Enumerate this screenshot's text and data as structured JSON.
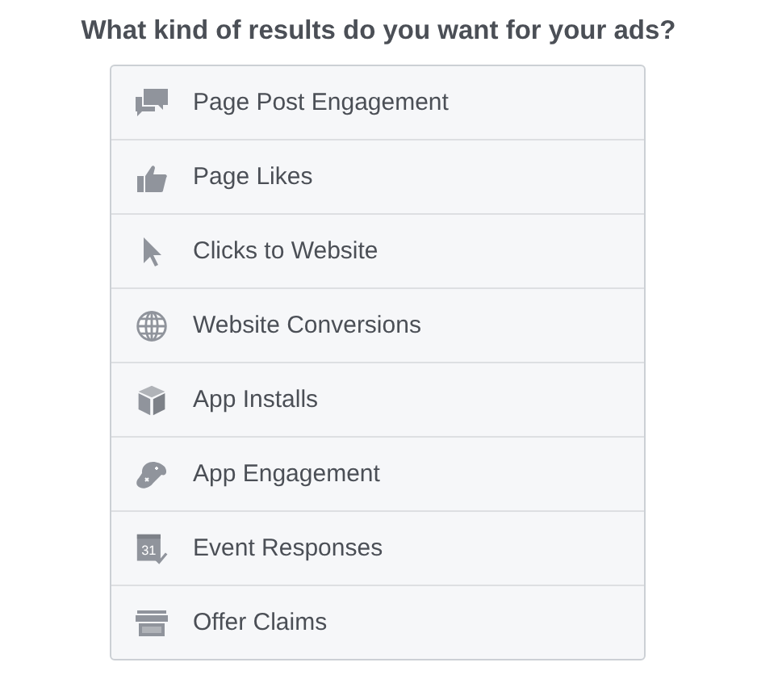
{
  "title": "What kind of results do you want for your ads?",
  "options": [
    {
      "kind": "comments",
      "label": "Page Post Engagement"
    },
    {
      "kind": "thumb",
      "label": "Page Likes"
    },
    {
      "kind": "cursor",
      "label": "Clicks to Website"
    },
    {
      "kind": "globe",
      "label": "Website Conversions"
    },
    {
      "kind": "box",
      "label": "App Installs"
    },
    {
      "kind": "gamepad",
      "label": "App Engagement"
    },
    {
      "kind": "calendar",
      "label": "Event Responses",
      "icon_text": "31"
    },
    {
      "kind": "store",
      "label": "Offer Claims"
    }
  ]
}
